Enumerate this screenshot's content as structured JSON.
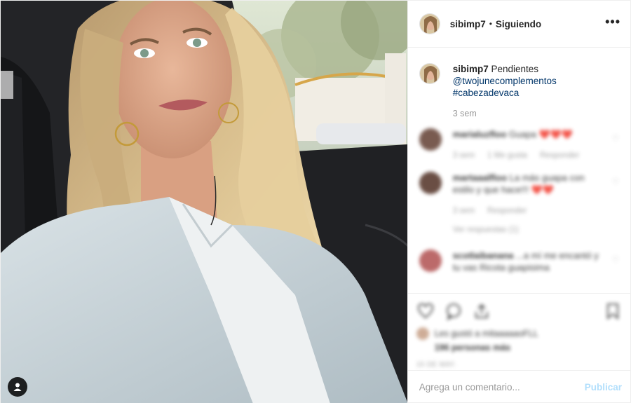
{
  "header": {
    "username": "sibimp7",
    "separator": "•",
    "follow_state": "Siguiendo",
    "more_icon": "ellipsis-icon"
  },
  "caption": {
    "username": "sibimp7",
    "text": "Pendientes",
    "mention": "@twojunecomplementos",
    "hashtag": "#cabezadevaca",
    "time": "3 sem"
  },
  "comments": [
    {
      "username": "marialuzfloo",
      "text": "Guapa ❤️❤️❤️",
      "meta": [
        "3 sem",
        "1 Me gusta",
        "Responder"
      ],
      "avatar_color": "#6b4a3e"
    },
    {
      "username": "martaaalfloo",
      "text": "La más guapa con estilo y que hace!!! ❤️❤️",
      "meta": [
        "3 sem",
        "Responder"
      ],
      "replies": "Ver respuestas (1)",
      "avatar_color": "#5a3b30"
    },
    {
      "username": "scotlaibanana",
      "text": "...a mí me encantó y tu vas Ricota guapisima",
      "meta": [],
      "avatar_color": "#b55a5a"
    }
  ],
  "actions": {
    "likes_line1": "Les gustó a mitaaaaaoFLL",
    "likes_line2": "196 personas más",
    "date": "15 DE MAY."
  },
  "add_comment": {
    "placeholder": "Agrega un comentario...",
    "publish_label": "Publicar"
  },
  "colors": {
    "link": "#003569",
    "muted": "#999999",
    "publish_disabled": "#b2dffc",
    "border": "#efefef"
  }
}
